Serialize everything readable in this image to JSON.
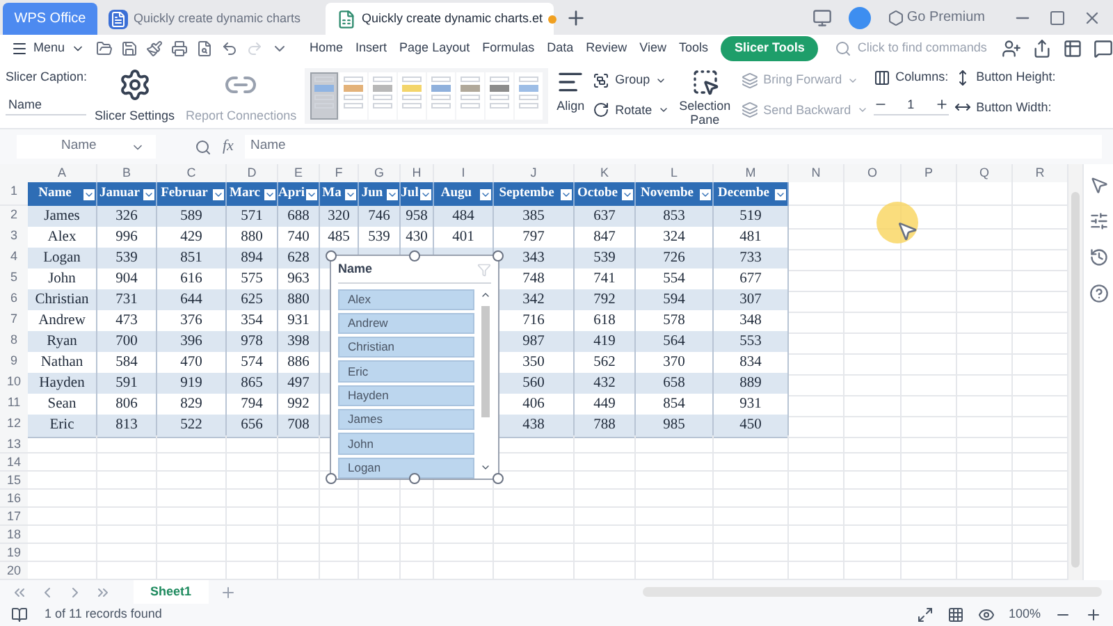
{
  "title_bar": {
    "tabs": [
      {
        "kind": "home",
        "label": "WPS Office",
        "selected": false,
        "unsaved": false
      },
      {
        "kind": "doc",
        "label": "Quickly create dynamic charts",
        "selected": false,
        "unsaved": false
      },
      {
        "kind": "sheet",
        "label": "Quickly create dynamic charts.et",
        "selected": true,
        "unsaved": true
      }
    ],
    "premium": "Go Premium"
  },
  "menu": {
    "label": "Menu",
    "tabs": [
      {
        "label": "Home",
        "selected": false
      },
      {
        "label": "Insert",
        "selected": false
      },
      {
        "label": "Page Layout",
        "selected": false
      },
      {
        "label": "Formulas",
        "selected": false
      },
      {
        "label": "Data",
        "selected": false
      },
      {
        "label": "Review",
        "selected": false
      },
      {
        "label": "View",
        "selected": false
      },
      {
        "label": "Tools",
        "selected": false
      },
      {
        "label": "Slicer Tools",
        "selected": true
      }
    ],
    "search": {
      "placeholder": "Click to find commands"
    }
  },
  "ribbon": {
    "caption_label": "Slicer Caption:",
    "caption_value": "Name",
    "buttons": [
      {
        "kind": "settings",
        "label": "Slicer Settings",
        "disabled": false
      },
      {
        "kind": "connections",
        "label": "Report Connections",
        "disabled": true
      }
    ],
    "styles": [
      {
        "color": "#8fb4e3",
        "selected": true
      },
      {
        "color": "#e3b27a",
        "selected": false
      },
      {
        "color": "#b8b8b8",
        "selected": false
      },
      {
        "color": "#f3d56b",
        "selected": false
      },
      {
        "color": "#8fb0dc",
        "selected": false
      },
      {
        "color": "#b0a89a",
        "selected": false
      },
      {
        "color": "#8c8c8c",
        "selected": false
      },
      {
        "color": "#9dbde6",
        "selected": false
      }
    ],
    "arrange": [
      {
        "kind": "align",
        "label": "Align",
        "disabled": false
      },
      {
        "kind": "group",
        "label": "Group",
        "disabled": false
      },
      {
        "kind": "rotate",
        "label": "Rotate",
        "disabled": false
      },
      {
        "kind": "pane",
        "label": "Selection Pane",
        "disabled": false
      },
      {
        "kind": "forward",
        "label": "Bring Forward",
        "disabled": true
      },
      {
        "kind": "backward",
        "label": "Send Backward",
        "disabled": true
      }
    ],
    "columns_label": "Columns:",
    "columns_value": "1",
    "height_label": "Button Height:",
    "width_label": "Button Width:"
  },
  "formula_bar": {
    "name_box": "Name",
    "function_label": "fx",
    "formula": "Name"
  },
  "sheet": {
    "columns": [
      "A",
      "B",
      "C",
      "D",
      "E",
      "F",
      "G",
      "H",
      "I",
      "J",
      "K",
      "L",
      "M",
      "N",
      "O",
      "P",
      "Q",
      "R"
    ],
    "row_numbers": [
      "1",
      "2",
      "3",
      "4",
      "5",
      "6",
      "7",
      "8",
      "9",
      "10",
      "11",
      "12",
      "13",
      "14",
      "15",
      "16",
      "17",
      "18",
      "19",
      "20"
    ],
    "header": [
      "Name",
      "Januar",
      "Februar",
      "Marc",
      "Apri",
      "Ma",
      "Jun",
      "Jul",
      "Augu",
      "Septembe",
      "Octobe",
      "Novembe",
      "Decembe"
    ],
    "rows": [
      [
        "James",
        "326",
        "589",
        "571",
        "688",
        "320",
        "746",
        "958",
        "484",
        "385",
        "637",
        "853",
        "519"
      ],
      [
        "Alex",
        "996",
        "429",
        "880",
        "740",
        "485",
        "539",
        "430",
        "401",
        "797",
        "847",
        "324",
        "481"
      ],
      [
        "Logan",
        "539",
        "851",
        "894",
        "628",
        null,
        null,
        null,
        null,
        "343",
        "539",
        "726",
        "733"
      ],
      [
        "John",
        "904",
        "616",
        "575",
        "963",
        null,
        null,
        null,
        null,
        "748",
        "741",
        "554",
        "677"
      ],
      [
        "Christian",
        "731",
        "644",
        "625",
        "880",
        null,
        null,
        null,
        null,
        "342",
        "792",
        "594",
        "307"
      ],
      [
        "Andrew",
        "473",
        "376",
        "354",
        "931",
        null,
        null,
        null,
        null,
        "716",
        "618",
        "578",
        "348"
      ],
      [
        "Ryan",
        "700",
        "396",
        "978",
        "398",
        null,
        null,
        null,
        null,
        "987",
        "419",
        "564",
        "553"
      ],
      [
        "Nathan",
        "584",
        "470",
        "574",
        "886",
        null,
        null,
        null,
        null,
        "350",
        "562",
        "370",
        "834"
      ],
      [
        "Hayden",
        "591",
        "919",
        "865",
        "497",
        null,
        null,
        null,
        null,
        "560",
        "432",
        "658",
        "889"
      ],
      [
        "Sean",
        "806",
        "829",
        "794",
        "992",
        null,
        null,
        null,
        null,
        "406",
        "449",
        "854",
        "931"
      ],
      [
        "Eric",
        "813",
        "522",
        "656",
        "708",
        null,
        null,
        null,
        null,
        "438",
        "788",
        "985",
        "450"
      ]
    ]
  },
  "slicer": {
    "title": "Name",
    "items": [
      {
        "label": "Alex",
        "selected": true
      },
      {
        "label": "Andrew",
        "selected": true
      },
      {
        "label": "Christian",
        "selected": true
      },
      {
        "label": "Eric",
        "selected": true
      },
      {
        "label": "Hayden",
        "selected": true
      },
      {
        "label": "James",
        "selected": true
      },
      {
        "label": "John",
        "selected": true
      },
      {
        "label": "Logan",
        "selected": true
      }
    ]
  },
  "sheet_tabs": [
    {
      "label": "Sheet1",
      "selected": true
    }
  ],
  "status_bar": {
    "message": "1 of 11 records found",
    "zoom": "100%"
  }
}
